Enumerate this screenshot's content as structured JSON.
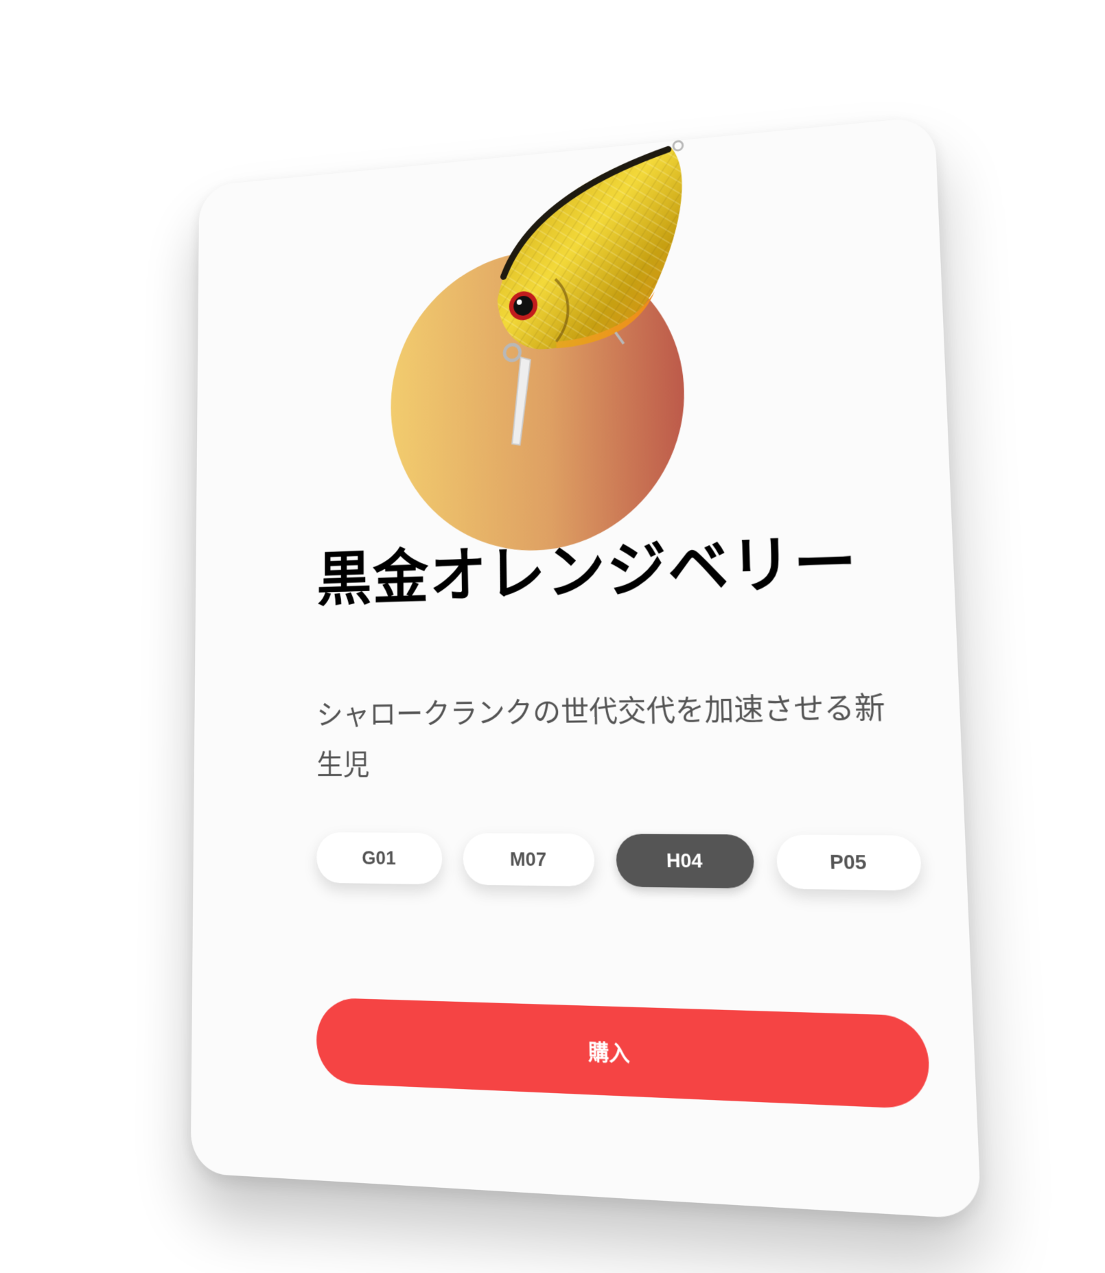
{
  "product": {
    "name": "黒金オレンジベリー",
    "description": "シャロークランクの世代交代を加速させる新生児",
    "image_icon": "crankbait-lure-image"
  },
  "variants": [
    {
      "code": "G01",
      "selected": false
    },
    {
      "code": "M07",
      "selected": false
    },
    {
      "code": "H04",
      "selected": true
    },
    {
      "code": "P05",
      "selected": false
    }
  ],
  "actions": {
    "buy_label": "購入"
  },
  "colors": {
    "accent": "#f54444",
    "selected_chip": "#555555",
    "gradient_start": "#f2cc6e",
    "gradient_end": "#bd5a4a",
    "card_background": "#fbfbfb"
  }
}
